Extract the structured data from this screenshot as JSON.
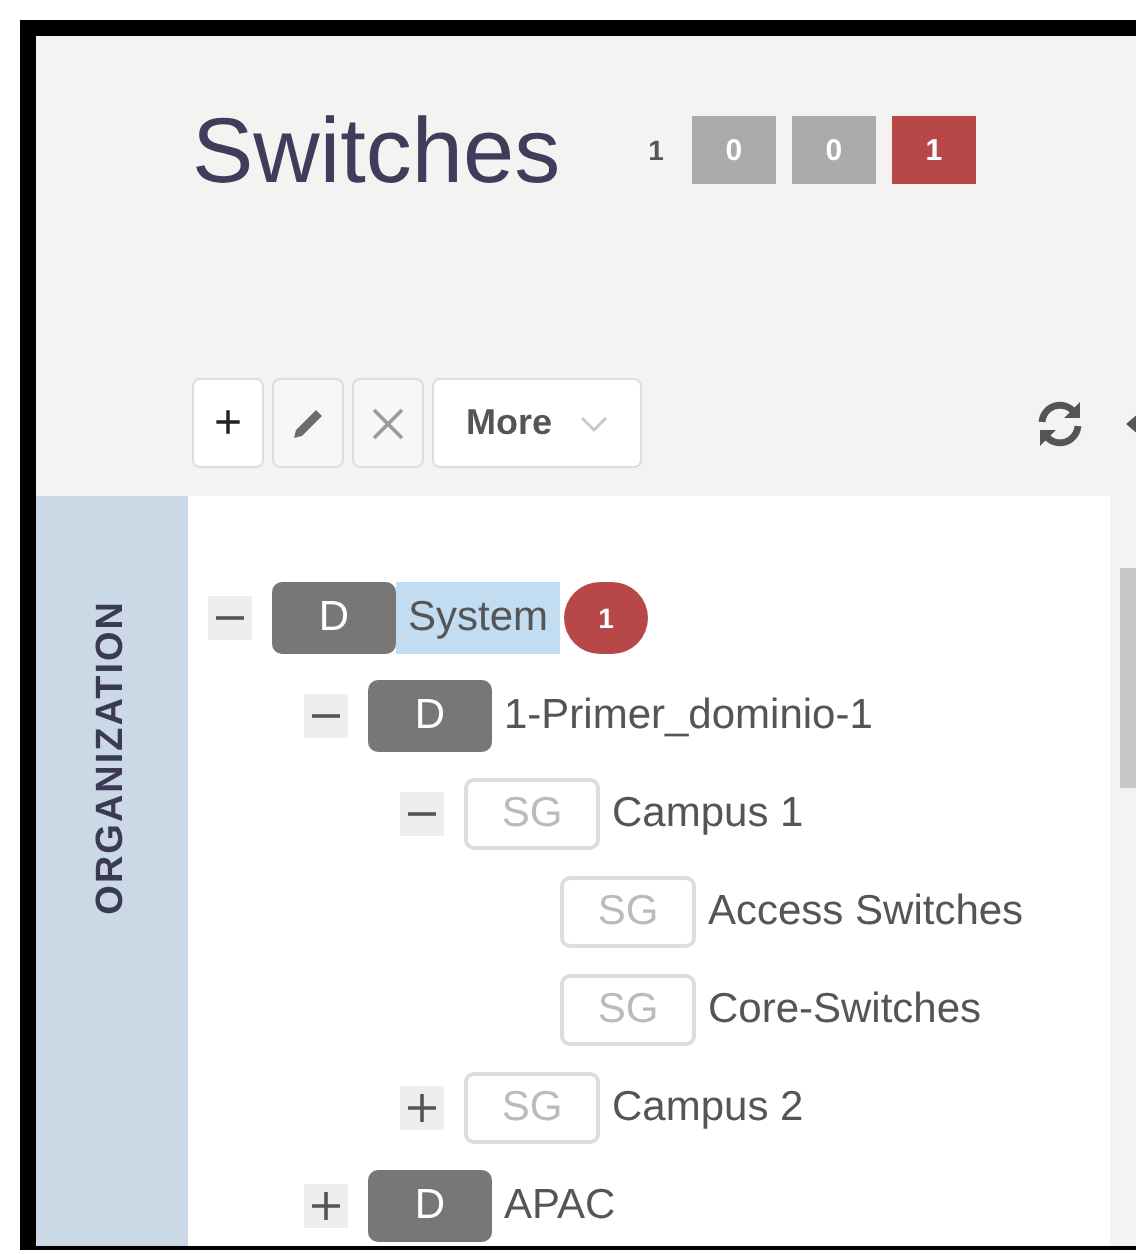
{
  "header": {
    "title": "Switches",
    "counters": [
      {
        "kind": "plain",
        "value": "1"
      },
      {
        "kind": "box",
        "value": "0",
        "color": "#ababab"
      },
      {
        "kind": "box",
        "value": "0",
        "color": "#ababab"
      },
      {
        "kind": "box",
        "value": "1",
        "color": "#b84848"
      }
    ]
  },
  "toolbar": {
    "buttons": [
      {
        "kind": "add",
        "label": "+",
        "disabled": false
      },
      {
        "kind": "edit",
        "disabled": true
      },
      {
        "kind": "delete",
        "disabled": true
      },
      {
        "kind": "menu",
        "label": "More",
        "disabled": false
      }
    ]
  },
  "sidebar": {
    "label": "ORGANIZATION"
  },
  "tree": [
    {
      "kind": "domain",
      "badge": "D",
      "label": "System",
      "selected": true,
      "alerts": "1",
      "expanded": true,
      "children": [
        {
          "kind": "domain",
          "badge": "D",
          "label": "1-Primer_dominio-1",
          "selected": false,
          "expanded": true,
          "children": [
            {
              "kind": "group",
              "badge": "SG",
              "label": "Campus 1",
              "selected": false,
              "expanded": true,
              "children": [
                {
                  "kind": "group",
                  "badge": "SG",
                  "label": "Access Switches",
                  "selected": false
                },
                {
                  "kind": "group",
                  "badge": "SG",
                  "label": "Core-Switches",
                  "selected": false
                }
              ]
            },
            {
              "kind": "group",
              "badge": "SG",
              "label": "Campus 2",
              "selected": false,
              "expanded": false
            }
          ]
        },
        {
          "kind": "domain",
          "badge": "D",
          "label": "APAC",
          "selected": false,
          "expanded": false
        }
      ]
    }
  ]
}
